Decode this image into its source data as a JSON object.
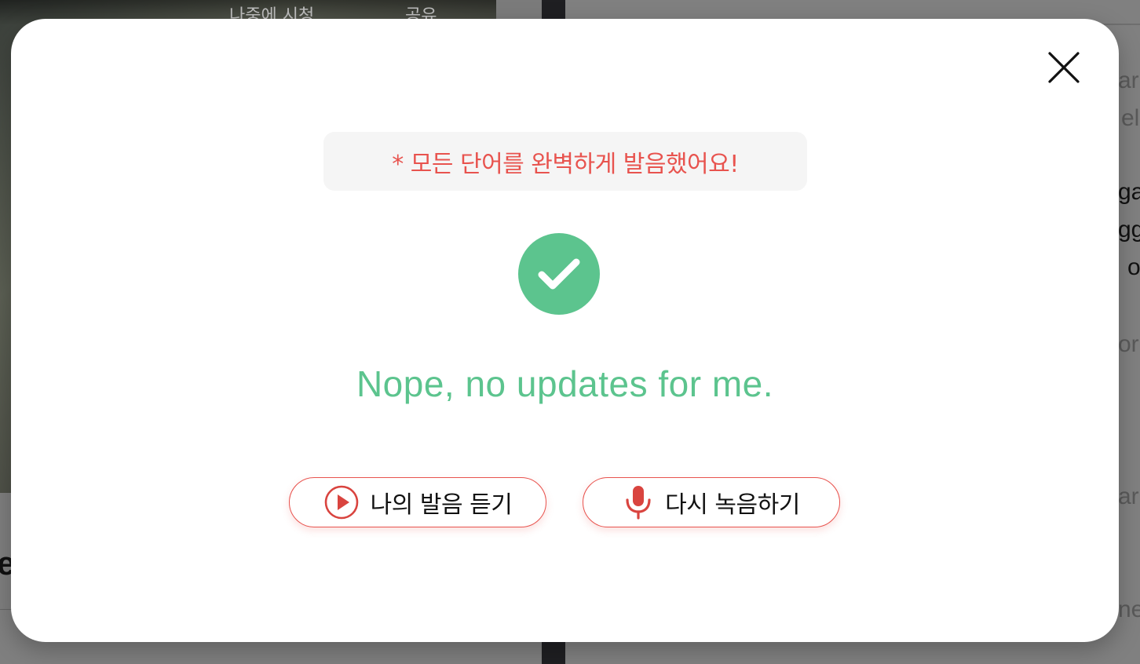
{
  "background": {
    "video_tabs": [
      "나중에 시청",
      "공유"
    ],
    "right_snippets": [
      "ar",
      "el",
      "ga",
      "gg",
      "o",
      "or",
      "ar",
      "ne"
    ],
    "left_snippet": "e"
  },
  "modal": {
    "message": "* 모든 단어를 완벽하게 발음했어요!",
    "sentence": "Nope, no updates for me.",
    "buttons": {
      "play_label": "나의 발음 듣기",
      "record_label": "다시 녹음하기"
    },
    "icons": {
      "close": "close-icon",
      "check": "check-icon",
      "play": "play-circle-icon",
      "mic": "microphone-icon"
    }
  },
  "colors": {
    "accent_red": "#e8534e",
    "success_green": "#5cc48e",
    "message_bg": "#f5f5f5"
  }
}
